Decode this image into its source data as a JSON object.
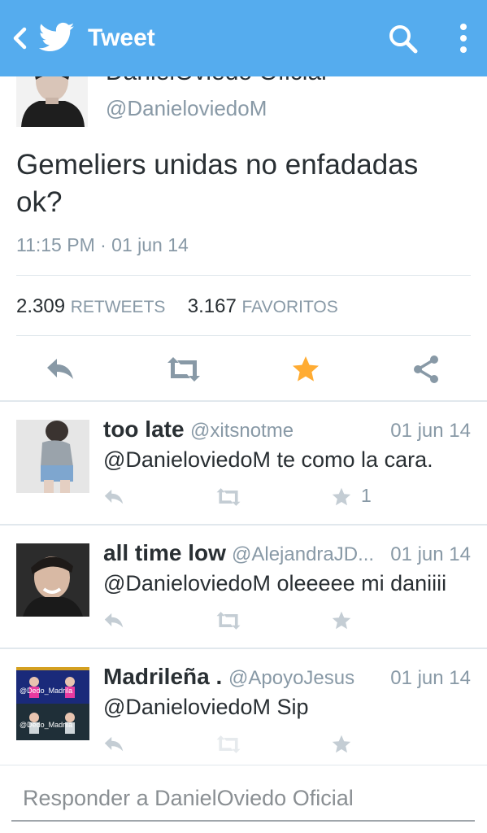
{
  "header": {
    "title": "Tweet",
    "background": "#55acee",
    "icons": [
      "back-chevron-icon",
      "twitter-bird-icon",
      "search-icon",
      "more-vertical-icon"
    ]
  },
  "tweet": {
    "author_name": "DanielOviedo Oficial",
    "author_handle": "@DanieloviedoM",
    "text": "Gemeliers unidas no enfadadas ok?",
    "timestamp": "11:15 PM · 01 jun 14",
    "retweets": "2.309",
    "retweets_label": "RETWEETS",
    "favorites": "3.167",
    "favorites_label": "FAVORITOS",
    "favorited": true,
    "favorite_color": "#ffac33",
    "actions": [
      "reply-icon",
      "retweet-icon",
      "favorite-star-icon",
      "share-icon"
    ]
  },
  "replies": [
    {
      "name": "too late",
      "handle": "@xitsnotme",
      "date": "01 jun 14",
      "text": "@DanieloviedoM te como la cara.",
      "favorite_count": "1"
    },
    {
      "name": "all time low",
      "handle": "@AlejandraJD...",
      "date": "01 jun 14",
      "text": "@DanieloviedoM oleeeee mi daniiii",
      "favorite_count": ""
    },
    {
      "name": "Madrileña .",
      "handle": "@ApoyoJesus",
      "date": "01 jun 14",
      "text": "@DanieloviedoM Sip",
      "favorite_count": "",
      "avatar_text": [
        "@Dedo_Madrila",
        "@Dedo_Madrila"
      ]
    }
  ],
  "composer": {
    "placeholder": "Responder a DanielOviedo Oficial"
  }
}
